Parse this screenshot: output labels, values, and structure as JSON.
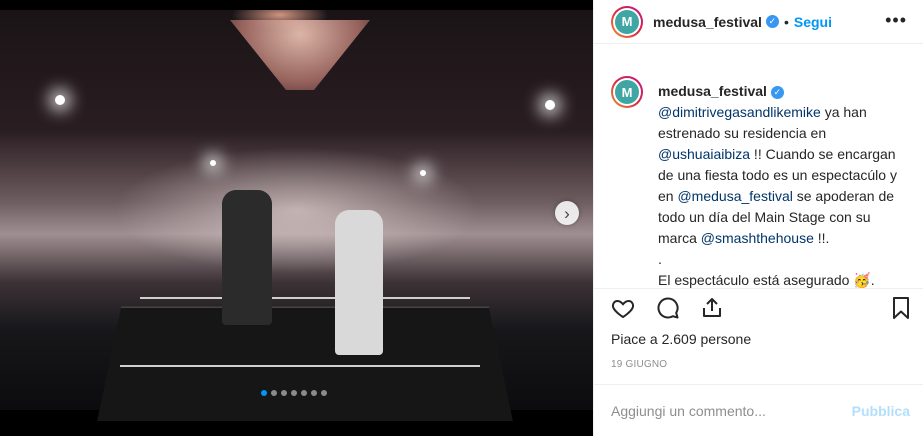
{
  "post": {
    "username": "medusa_festival",
    "avatar_initials": "M",
    "follow_label": "Segui",
    "separator": "•",
    "more_label": "•••",
    "nav_arrow": "›"
  },
  "caption": {
    "username": "medusa_festival",
    "mention_1": "@dimitrivegasandlikemike",
    "text_1": " ya han estrenado su residencia en ",
    "mention_2": "@ushuaiaibiza",
    "text_2": " !! Cuando se encargan de una fiesta todo es un espectacúlo y en ",
    "mention_3": "@medusa_festival",
    "text_3": " se apoderan de todo un día del Main Stage con su marca ",
    "mention_4": "@smashthehouse",
    "text_4": " !!.",
    "line_dot": ".",
    "line_last": "El espectáculo está asegurado 🥳."
  },
  "stats": {
    "likes": "Piace a 2.609 persone",
    "date": "19 GIUGNO"
  },
  "comment": {
    "placeholder": "Aggiungi un commento...",
    "publish_label": "Pubblica"
  },
  "carousel": {
    "total": 7,
    "active_index": 0
  },
  "colors": {
    "accent": "#0095f6",
    "mention": "#003569",
    "publish_disabled": "#b2dffc",
    "muted": "#8e8e8e",
    "avatar": "#3fa6a3"
  },
  "icons": [
    "heart-icon",
    "comment-icon",
    "share-icon",
    "bookmark-icon",
    "verified-icon",
    "chevron-right-icon"
  ]
}
